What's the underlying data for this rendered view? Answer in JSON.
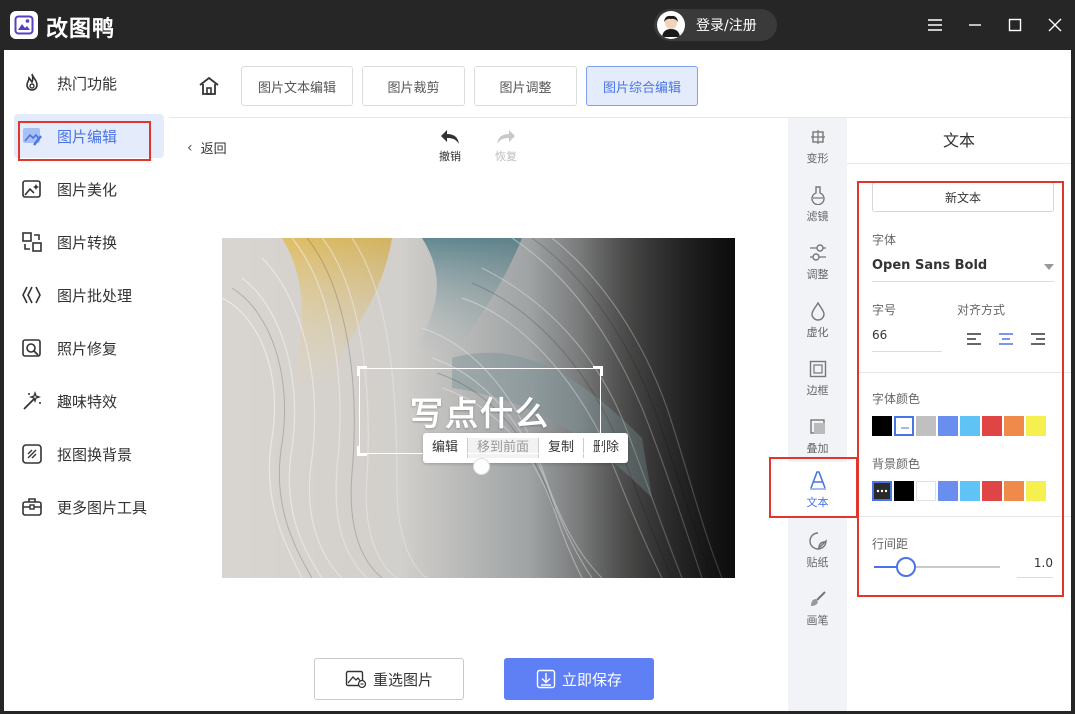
{
  "app": {
    "title": "改图鸭",
    "login_label": "登录/注册"
  },
  "sidebar": {
    "items": [
      {
        "label": "热门功能",
        "icon": "fire-icon"
      },
      {
        "label": "图片编辑",
        "icon": "image-edit-icon",
        "active": true
      },
      {
        "label": "图片美化",
        "icon": "image-beautify-icon"
      },
      {
        "label": "图片转换",
        "icon": "image-convert-icon"
      },
      {
        "label": "图片批处理",
        "icon": "batch-icon"
      },
      {
        "label": "照片修复",
        "icon": "photo-repair-icon"
      },
      {
        "label": "趣味特效",
        "icon": "magic-wand-icon"
      },
      {
        "label": "抠图换背景",
        "icon": "cutout-icon"
      },
      {
        "label": "更多图片工具",
        "icon": "toolbox-icon"
      }
    ]
  },
  "tabs": [
    {
      "label": "图片文本编辑"
    },
    {
      "label": "图片裁剪"
    },
    {
      "label": "图片调整"
    },
    {
      "label": "图片综合编辑",
      "active": true
    }
  ],
  "canvas": {
    "back_label": "返回",
    "undo_label": "撤销",
    "redo_label": "恢复",
    "context_menu": [
      "编辑",
      "移到前面",
      "复制",
      "删除"
    ],
    "text_content": "写点什么",
    "reselect_label": "重选图片",
    "save_label": "立即保存"
  },
  "tools": [
    {
      "label": "变形",
      "icon": "transform-icon"
    },
    {
      "label": "滤镜",
      "icon": "filter-icon"
    },
    {
      "label": "调整",
      "icon": "adjust-icon"
    },
    {
      "label": "虚化",
      "icon": "blur-icon"
    },
    {
      "label": "边框",
      "icon": "border-icon"
    },
    {
      "label": "叠加",
      "icon": "overlay-icon"
    },
    {
      "label": "文本",
      "icon": "text-icon",
      "active": true
    },
    {
      "label": "贴纸",
      "icon": "sticker-icon"
    },
    {
      "label": "画笔",
      "icon": "brush-icon"
    }
  ],
  "panel": {
    "title": "文本",
    "new_text_label": "新文本",
    "font_label": "字体",
    "font_value": "Open Sans Bold",
    "size_label": "字号",
    "size_value": "66",
    "align_label": "对齐方式",
    "align_selected": "center",
    "font_color_label": "字体颜色",
    "font_colors": [
      "#000000",
      "#ffffff",
      "#c0c0c0",
      "#6a8ef0",
      "#5fc4f5",
      "#e04545",
      "#f08a4b",
      "#f5f04f"
    ],
    "font_color_selected": 1,
    "bg_color_label": "背景颜色",
    "bg_colors": [
      "none",
      "#000000",
      "#ffffff",
      "#6a8ef0",
      "#5fc4f5",
      "#e04545",
      "#f08a4b",
      "#f5f04f"
    ],
    "bg_color_selected": 0,
    "line_spacing_label": "行间距",
    "line_spacing_value": "1.0",
    "line_spacing_fraction": 0.25
  },
  "colors": {
    "accent": "#4a74e6",
    "save_button": "#5f7ff5",
    "highlight": "#e0362b",
    "titlebar": "#262626"
  }
}
